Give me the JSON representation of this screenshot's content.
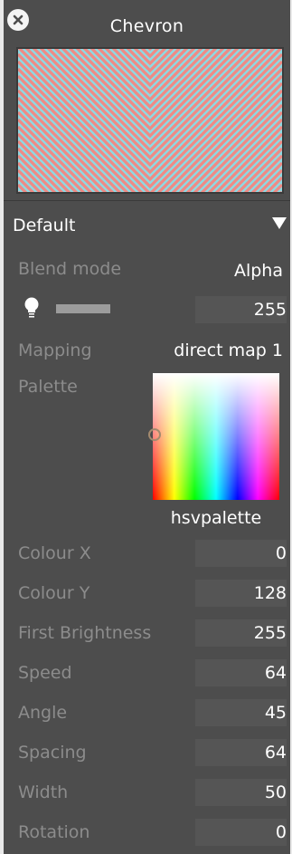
{
  "window": {
    "title": "Chevron"
  },
  "preset": {
    "selected": "Default"
  },
  "blend_mode": {
    "label": "Blend mode",
    "value": "Alpha"
  },
  "brightness": {
    "value": "255",
    "level_fraction": 0.25
  },
  "mapping": {
    "label": "Mapping",
    "value": "direct map 1"
  },
  "palette": {
    "label": "Palette",
    "name": "hsvpalette"
  },
  "params": [
    {
      "label": "Colour X",
      "value": "0"
    },
    {
      "label": "Colour Y",
      "value": "128"
    },
    {
      "label": "First Brightness",
      "value": "255"
    },
    {
      "label": "Speed",
      "value": "64"
    },
    {
      "label": "Angle",
      "value": "45"
    },
    {
      "label": "Spacing",
      "value": "64"
    },
    {
      "label": "Width",
      "value": "50"
    },
    {
      "label": "Rotation",
      "value": "0"
    }
  ],
  "colors": {
    "panel_bg": "#4d4d4d",
    "chevron_a": "#8ed9e2",
    "chevron_b": "#f08a84",
    "muted_label": "#8c8c8c"
  },
  "icons": {
    "close": "close-icon",
    "brightness": "lightbulb-icon",
    "dropdown": "triangle-down-icon"
  }
}
